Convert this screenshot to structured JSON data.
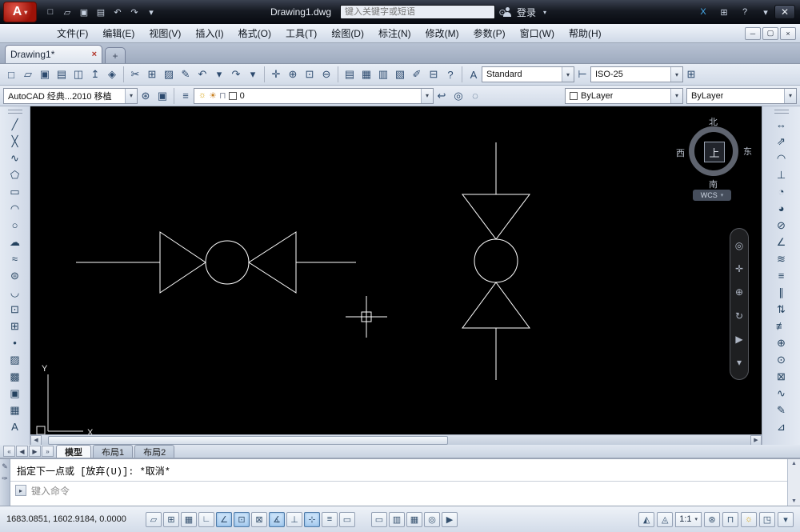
{
  "titlebar": {
    "logo_letter": "A",
    "logo_arrow": "▾",
    "qat_icons": [
      {
        "name": "qat-new-icon",
        "glyph": "□"
      },
      {
        "name": "qat-open-icon",
        "glyph": "▱"
      },
      {
        "name": "qat-save-icon",
        "glyph": "▣"
      },
      {
        "name": "qat-plot-icon",
        "glyph": "▤"
      },
      {
        "name": "qat-undo-icon",
        "glyph": "↶"
      },
      {
        "name": "qat-redo-icon",
        "glyph": "↷"
      },
      {
        "name": "qat-menu-arrow-icon",
        "glyph": "▾"
      }
    ],
    "title": "Drawing1.dwg",
    "search": {
      "placeholder": "键入关键字或短语"
    },
    "search_go_glyph": "⊙",
    "login_label": "登录",
    "login_arrow": "▾",
    "right_icons": [
      {
        "name": "exchange-apps-icon",
        "glyph": "X",
        "color": "#49b0f2"
      },
      {
        "name": "subscription-icon",
        "glyph": "⊞"
      },
      {
        "name": "help-icon",
        "glyph": "?"
      },
      {
        "name": "infocenter-menu-icon",
        "glyph": "▾"
      }
    ],
    "close_glyph": "✕"
  },
  "menubar": {
    "items": [
      {
        "name": "menu-file",
        "label": "文件(F)"
      },
      {
        "name": "menu-edit",
        "label": "编辑(E)"
      },
      {
        "name": "menu-view",
        "label": "视图(V)"
      },
      {
        "name": "menu-insert",
        "label": "插入(I)"
      },
      {
        "name": "menu-format",
        "label": "格式(O)"
      },
      {
        "name": "menu-tools",
        "label": "工具(T)"
      },
      {
        "name": "menu-draw",
        "label": "绘图(D)"
      },
      {
        "name": "menu-dimension",
        "label": "标注(N)"
      },
      {
        "name": "menu-modify",
        "label": "修改(M)"
      },
      {
        "name": "menu-parametric",
        "label": "参数(P)"
      },
      {
        "name": "menu-window",
        "label": "窗口(W)"
      },
      {
        "name": "menu-help",
        "label": "帮助(H)"
      }
    ],
    "controls": [
      {
        "name": "mdi-minimize-button",
        "glyph": "─"
      },
      {
        "name": "mdi-restore-button",
        "glyph": "▢"
      },
      {
        "name": "mdi-close-button",
        "glyph": "×"
      }
    ]
  },
  "tabbar": {
    "tab_label": "Drawing1*",
    "tab_close_glyph": "×",
    "new_tab_glyph": "+"
  },
  "toolbar1": {
    "file_icons": [
      {
        "name": "new-icon",
        "glyph": "□"
      },
      {
        "name": "open-icon",
        "glyph": "▱"
      },
      {
        "name": "save-icon",
        "glyph": "▣"
      },
      {
        "name": "plot-icon",
        "glyph": "▤"
      },
      {
        "name": "plot-preview-icon",
        "glyph": "◫"
      },
      {
        "name": "publish-icon",
        "glyph": "↥"
      },
      {
        "name": "export-dwf-icon",
        "glyph": "◈"
      }
    ],
    "edit_icons": [
      {
        "name": "cut-icon",
        "glyph": "✂"
      },
      {
        "name": "copy-icon",
        "glyph": "⊞"
      },
      {
        "name": "paste-icon",
        "glyph": "▨"
      },
      {
        "name": "match-properties-icon",
        "glyph": "✎"
      },
      {
        "name": "undo-icon",
        "glyph": "↶"
      },
      {
        "name": "undo-arrow-icon",
        "glyph": "▾"
      },
      {
        "name": "redo-icon",
        "glyph": "↷"
      },
      {
        "name": "redo-arrow-icon",
        "glyph": "▾"
      }
    ],
    "view_icons": [
      {
        "name": "pan-realtime-icon",
        "glyph": "✛"
      },
      {
        "name": "zoom-realtime-icon",
        "glyph": "⊕"
      },
      {
        "name": "zoom-window-icon",
        "glyph": "⊡"
      },
      {
        "name": "zoom-previous-icon",
        "glyph": "⊖"
      }
    ],
    "palette_icons": [
      {
        "name": "properties-icon",
        "glyph": "▤"
      },
      {
        "name": "designcenter-icon",
        "glyph": "▦"
      },
      {
        "name": "toolpalettes-icon",
        "glyph": "▥"
      },
      {
        "name": "sheetset-icon",
        "glyph": "▧"
      },
      {
        "name": "markup-icon",
        "glyph": "✐"
      },
      {
        "name": "quickcalc-icon",
        "glyph": "⊟"
      },
      {
        "name": "help2-icon",
        "glyph": "?"
      }
    ],
    "text_style_icon": "A",
    "text_style_value": "Standard",
    "dim_style_icon": "⊢",
    "dim_style_value": "ISO-25",
    "table_style_icon": "⊞"
  },
  "toolbar2": {
    "workspace_value": "AutoCAD 经典...2010 移植",
    "workspace_icons": [
      {
        "name": "workspace-settings-icon",
        "glyph": "⊛"
      },
      {
        "name": "workspace-save-icon",
        "glyph": "▣"
      }
    ],
    "layer_properties_glyph": "≡",
    "layer_combo": {
      "icons": [
        {
          "name": "layer-on-icon",
          "glyph": "☼",
          "color": "#d9a514"
        },
        {
          "name": "layer-freeze-icon",
          "glyph": "☀",
          "color": "#c77e1e"
        },
        {
          "name": "layer-lock-icon",
          "glyph": "⊓",
          "color": "#7d8596"
        }
      ],
      "value": "0"
    },
    "layer_tool_icons": [
      {
        "name": "layer-previous-icon",
        "glyph": "↩"
      },
      {
        "name": "layer-isolate-icon",
        "glyph": "◎"
      },
      {
        "name": "layer-unisolate-icon",
        "glyph": "◌"
      }
    ],
    "color_value": "ByLayer",
    "linetype_value": "ByLayer"
  },
  "left_toolbar": {
    "icons": [
      {
        "name": "line-icon",
        "glyph": "╱"
      },
      {
        "name": "construction-line-icon",
        "glyph": "╳"
      },
      {
        "name": "polyline-icon",
        "glyph": "∿"
      },
      {
        "name": "polygon-icon",
        "glyph": "⬠"
      },
      {
        "name": "rectangle-icon",
        "glyph": "▭"
      },
      {
        "name": "arc-icon",
        "glyph": "◠"
      },
      {
        "name": "circle-icon",
        "glyph": "○"
      },
      {
        "name": "revcloud-icon",
        "glyph": "☁"
      },
      {
        "name": "spline-icon",
        "glyph": "≈"
      },
      {
        "name": "ellipse-icon",
        "glyph": "⊜"
      },
      {
        "name": "ellipse-arc-icon",
        "glyph": "◡"
      },
      {
        "name": "insert-block-icon",
        "glyph": "⊡"
      },
      {
        "name": "make-block-icon",
        "glyph": "⊞"
      },
      {
        "name": "point-icon",
        "glyph": "•"
      },
      {
        "name": "hatch-icon",
        "glyph": "▨"
      },
      {
        "name": "gradient-icon",
        "glyph": "▩"
      },
      {
        "name": "region-icon",
        "glyph": "▣"
      },
      {
        "name": "table-icon",
        "glyph": "▦"
      },
      {
        "name": "mtext-icon",
        "glyph": "A"
      }
    ]
  },
  "right_toolbar": {
    "icons": [
      {
        "name": "dim-linear-icon",
        "glyph": "↔"
      },
      {
        "name": "dim-aligned-icon",
        "glyph": "⇗"
      },
      {
        "name": "dim-arc-length-icon",
        "glyph": "◠"
      },
      {
        "name": "dim-ordinate-icon",
        "glyph": "⊥"
      },
      {
        "name": "dim-radius-icon",
        "glyph": "◔"
      },
      {
        "name": "dim-jogged-icon",
        "glyph": "◕"
      },
      {
        "name": "dim-diameter-icon",
        "glyph": "⊘"
      },
      {
        "name": "dim-angular-icon",
        "glyph": "∠"
      },
      {
        "name": "quick-dim-icon",
        "glyph": "≋"
      },
      {
        "name": "dim-baseline-icon",
        "glyph": "≡"
      },
      {
        "name": "dim-continue-icon",
        "glyph": "∥"
      },
      {
        "name": "dim-space-icon",
        "glyph": "⇅"
      },
      {
        "name": "dim-break-icon",
        "glyph": "≢"
      },
      {
        "name": "tolerance-icon",
        "glyph": "⊕"
      },
      {
        "name": "center-mark-icon",
        "glyph": "⊙"
      },
      {
        "name": "dim-inspect-icon",
        "glyph": "⊠"
      },
      {
        "name": "dim-jog-line-icon",
        "glyph": "∿"
      },
      {
        "name": "dim-edit-icon",
        "glyph": "✎"
      },
      {
        "name": "dim-style-manager-icon",
        "glyph": "⊿"
      }
    ]
  },
  "canvas": {
    "compass": {
      "north": "北",
      "west": "西",
      "east": "东",
      "south": "南",
      "center": "上",
      "wcs_label": "WCS",
      "wcs_arrow": "▾"
    },
    "navbar_icons": [
      {
        "name": "nav-wheel-icon",
        "glyph": "◎"
      },
      {
        "name": "nav-pan-icon",
        "glyph": "✛"
      },
      {
        "name": "nav-zoom-icon",
        "glyph": "⊕"
      },
      {
        "name": "nav-orbit-icon",
        "glyph": "↻"
      },
      {
        "name": "nav-showmotion-icon",
        "glyph": "▶"
      },
      {
        "name": "nav-menu-icon",
        "glyph": "▾"
      }
    ],
    "ucs": {
      "x_label": "X",
      "y_label": "Y"
    },
    "scrollbar": {
      "left_glyph": "◀",
      "right_glyph": "▶"
    }
  },
  "layout_row": {
    "nav_icons": [
      {
        "name": "first-layout-icon",
        "glyph": "«"
      },
      {
        "name": "prev-layout-icon",
        "glyph": "◀"
      },
      {
        "name": "next-layout-icon",
        "glyph": "▶"
      },
      {
        "name": "last-layout-icon",
        "glyph": "»"
      }
    ],
    "tabs": [
      {
        "name": "tab-model",
        "label": "模型",
        "active": true
      },
      {
        "name": "tab-layout1",
        "label": "布局1"
      },
      {
        "name": "tab-layout2",
        "label": "布局2"
      }
    ]
  },
  "command": {
    "grip_pencil_glyph": "✎",
    "grip_wrench_glyph": "✑",
    "history_line": "指定下一点或 [放弃(U)]: *取消*",
    "input_icon_glyph": "▸",
    "prompt_placeholder": "键入命令",
    "scroll_up_glyph": "▲",
    "scroll_down_glyph": "▼"
  },
  "statusbar": {
    "coords": "1683.0851, 1602.9184, 0.0000",
    "toggles": [
      {
        "name": "infer-constraints-toggle",
        "glyph": "▱"
      },
      {
        "name": "snap-toggle",
        "glyph": "⊞"
      },
      {
        "name": "grid-toggle",
        "glyph": "▦"
      },
      {
        "name": "ortho-toggle",
        "glyph": "∟"
      },
      {
        "name": "polar-toggle",
        "glyph": "∠",
        "active": true
      },
      {
        "name": "osnap-toggle",
        "glyph": "⊡",
        "active": true
      },
      {
        "name": "osnap3d-toggle",
        "glyph": "⊠"
      },
      {
        "name": "otrack-toggle",
        "glyph": "∡",
        "active": true
      },
      {
        "name": "ducs-toggle",
        "glyph": "⊥"
      },
      {
        "name": "dyn-toggle",
        "glyph": "⊹",
        "active": true
      },
      {
        "name": "lwt-toggle",
        "glyph": "≡"
      },
      {
        "name": "qp-toggle",
        "glyph": "▭"
      }
    ],
    "middle_icons": [
      {
        "name": "model-space-button",
        "glyph": "▭"
      },
      {
        "name": "quick-view-layouts-button",
        "glyph": "▥"
      },
      {
        "name": "quick-view-drawings-button",
        "glyph": "▦"
      },
      {
        "name": "steering-wheel-button",
        "glyph": "◎"
      },
      {
        "name": "show-motion-button",
        "glyph": "▶"
      }
    ],
    "annotation_icons": [
      {
        "name": "annotation-visibility-button",
        "glyph": "◭"
      },
      {
        "name": "annotation-autoscale-button",
        "glyph": "◬"
      }
    ],
    "scale_value": "1:1",
    "scale_arrow": "▾",
    "right_icons": [
      {
        "name": "workspace-switching-button",
        "glyph": "⊛"
      },
      {
        "name": "toolbar-lock-button",
        "glyph": "⊓"
      },
      {
        "name": "isolate-objects-button",
        "glyph": "☼",
        "color": "#d9a514"
      },
      {
        "name": "clean-screen-button",
        "glyph": "◳"
      },
      {
        "name": "status-menu-button",
        "glyph": "▾"
      }
    ]
  }
}
